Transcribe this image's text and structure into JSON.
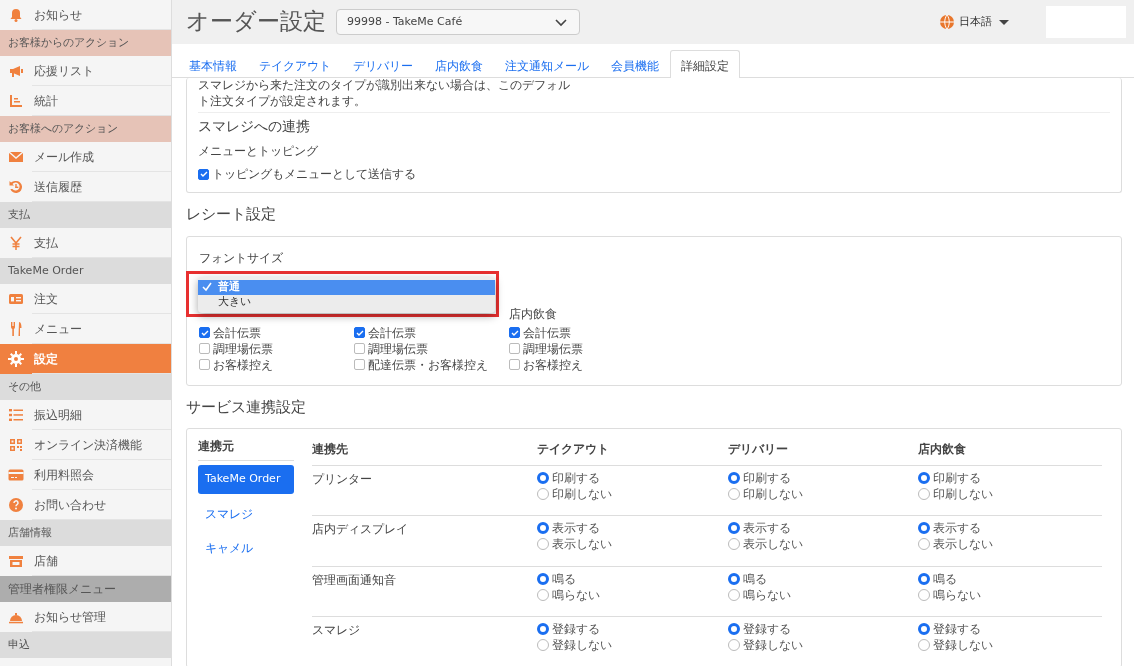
{
  "sidebar": {
    "items": [
      {
        "kind": "item",
        "label": "お知らせ",
        "selected": false
      },
      {
        "kind": "section",
        "label": "お客様からのアクション",
        "color": "#e6c3b7"
      },
      {
        "kind": "item",
        "label": "応援リスト",
        "selected": false
      },
      {
        "kind": "item",
        "label": "統計",
        "selected": false
      },
      {
        "kind": "section",
        "label": "お客様へのアクション",
        "color": "#e6c3b7"
      },
      {
        "kind": "item",
        "label": "メール作成",
        "selected": false
      },
      {
        "kind": "item",
        "label": "送信履歴",
        "selected": false
      },
      {
        "kind": "section",
        "label": "支払",
        "color": "#dcdcdc"
      },
      {
        "kind": "item",
        "label": "支払",
        "selected": false
      },
      {
        "kind": "section",
        "label": "TakeMe Order",
        "color": "#dcdcdc"
      },
      {
        "kind": "item",
        "label": "注文",
        "selected": false
      },
      {
        "kind": "item",
        "label": "メニュー",
        "selected": false
      },
      {
        "kind": "item",
        "label": "設定",
        "selected": true
      },
      {
        "kind": "section",
        "label": "その他",
        "color": "#dcdcdc"
      },
      {
        "kind": "item",
        "label": "振込明細",
        "selected": false
      },
      {
        "kind": "item",
        "label": "オンライン決済機能",
        "selected": false
      },
      {
        "kind": "item",
        "label": "利用料照会",
        "selected": false
      },
      {
        "kind": "item",
        "label": "お問い合わせ",
        "selected": false
      },
      {
        "kind": "section",
        "label": "店舗情報",
        "color": "#dcdcdc"
      },
      {
        "kind": "item",
        "label": "店舗",
        "selected": false
      },
      {
        "kind": "section",
        "label": "管理者権限メニュー",
        "color": "#adadad"
      },
      {
        "kind": "item",
        "label": "お知らせ管理",
        "selected": false
      },
      {
        "kind": "section",
        "label": "申込",
        "color": "#dcdcdc"
      }
    ]
  },
  "header": {
    "title": "オーダー設定",
    "shop_select": "99998 - TakeMe Café",
    "language": "日本語"
  },
  "tabs": [
    {
      "label": "基本情報",
      "selected": false
    },
    {
      "label": "テイクアウト",
      "selected": false
    },
    {
      "label": "デリバリー",
      "selected": false
    },
    {
      "label": "店内飲食",
      "selected": false
    },
    {
      "label": "注文通知メール",
      "selected": false
    },
    {
      "label": "会員機能",
      "selected": false
    },
    {
      "label": "詳細設定",
      "selected": true
    }
  ],
  "smaregi_card": {
    "note_lines": [
      "スマレジから来た注文のタイプが識別出来ない場合は、このデフォル",
      "ト注文タイプが設定されます。"
    ],
    "title": "スマレジへの連携",
    "subtitle": "メニューとトッピング",
    "checkbox": {
      "label": "トッピングもメニューとして送信する",
      "checked": true
    }
  },
  "receipt": {
    "title": "レシート設定",
    "font_size": {
      "label": "フォントサイズ",
      "options": [
        {
          "label": "普通",
          "selected": true
        },
        {
          "label": "大きい",
          "selected": false
        }
      ]
    },
    "columns": [
      {
        "items": [
          {
            "label": "会計伝票",
            "checked": true
          },
          {
            "label": "調理場伝票",
            "checked": false
          },
          {
            "label": "お客様控え",
            "checked": false
          }
        ]
      },
      {
        "items": [
          {
            "label": "会計伝票",
            "checked": true
          },
          {
            "label": "調理場伝票",
            "checked": false
          },
          {
            "label": "配達伝票・お客様控え",
            "checked": false
          }
        ]
      },
      {
        "heading": "店内飲食",
        "items": [
          {
            "label": "会計伝票",
            "checked": true
          },
          {
            "label": "調理場伝票",
            "checked": false
          },
          {
            "label": "お客様控え",
            "checked": false
          }
        ]
      }
    ]
  },
  "services": {
    "title": "サービス連携設定",
    "source_heading": "連携元",
    "sources": [
      {
        "label": "TakeMe Order",
        "selected": true
      },
      {
        "label": "スマレジ",
        "selected": false
      },
      {
        "label": "キャメル",
        "selected": false
      }
    ],
    "name_heading": "連携先",
    "columns": [
      "テイクアウト",
      "デリバリー",
      "店内飲食"
    ],
    "rows": [
      {
        "name": "プリンター",
        "cells": [
          [
            {
              "label": "印刷する",
              "selected": true
            },
            {
              "label": "印刷しない",
              "selected": false
            }
          ],
          [
            {
              "label": "印刷する",
              "selected": true
            },
            {
              "label": "印刷しない",
              "selected": false
            }
          ],
          [
            {
              "label": "印刷する",
              "selected": true
            },
            {
              "label": "印刷しない",
              "selected": false
            }
          ]
        ]
      },
      {
        "name": "店内ディスプレイ",
        "cells": [
          [
            {
              "label": "表示する",
              "selected": true
            },
            {
              "label": "表示しない",
              "selected": false
            }
          ],
          [
            {
              "label": "表示する",
              "selected": true
            },
            {
              "label": "表示しない",
              "selected": false
            }
          ],
          [
            {
              "label": "表示する",
              "selected": true
            },
            {
              "label": "表示しない",
              "selected": false
            }
          ]
        ]
      },
      {
        "name": "管理画面通知音",
        "cells": [
          [
            {
              "label": "鳴る",
              "selected": true
            },
            {
              "label": "鳴らない",
              "selected": false
            }
          ],
          [
            {
              "label": "鳴る",
              "selected": true
            },
            {
              "label": "鳴らない",
              "selected": false
            }
          ],
          [
            {
              "label": "鳴る",
              "selected": true
            },
            {
              "label": "鳴らない",
              "selected": false
            }
          ]
        ]
      },
      {
        "name": "スマレジ",
        "cells": [
          [
            {
              "label": "登録する",
              "selected": true
            },
            {
              "label": "登録しない",
              "selected": false
            }
          ],
          [
            {
              "label": "登録する",
              "selected": true
            },
            {
              "label": "登録しない",
              "selected": false
            }
          ],
          [
            {
              "label": "登録する",
              "selected": true
            },
            {
              "label": "登録しない",
              "selected": false
            }
          ]
        ]
      }
    ]
  }
}
